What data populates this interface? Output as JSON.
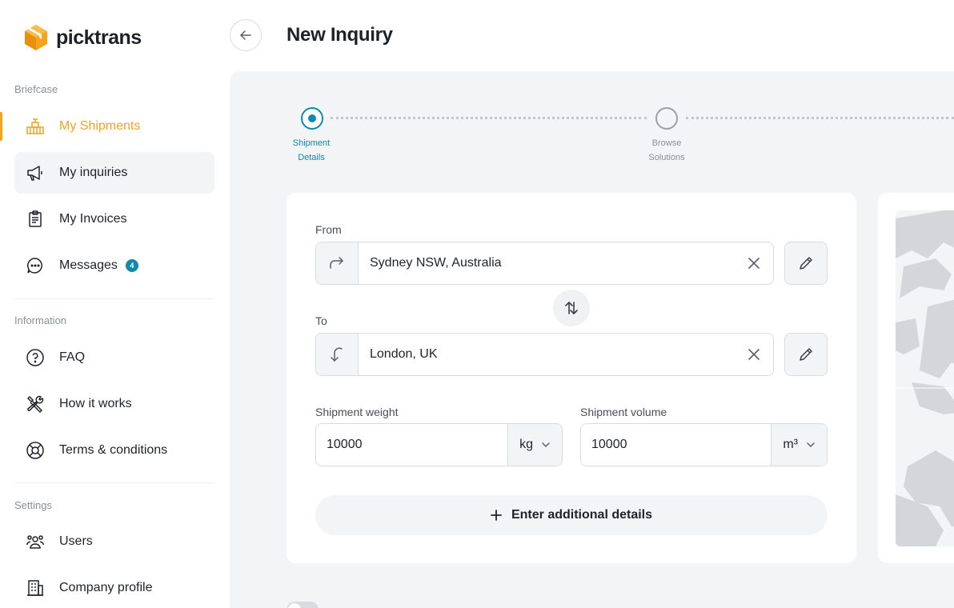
{
  "app": {
    "name": "picktrans",
    "brand_color": "#f5a21d",
    "accent_color": "#0e8ba8"
  },
  "sidebar": {
    "sections": [
      {
        "label": "Briefcase"
      },
      {
        "label": "Information"
      },
      {
        "label": "Settings"
      }
    ],
    "items": [
      {
        "label": "My Shipments",
        "icon": "warehouse-icon",
        "active": true
      },
      {
        "label": "My inquiries",
        "icon": "megaphone-icon"
      },
      {
        "label": "My Invoices",
        "icon": "invoice-icon"
      },
      {
        "label": "Messages",
        "icon": "chat-bubble-icon",
        "badge": "4"
      },
      {
        "label": "FAQ",
        "icon": "question-circle-icon"
      },
      {
        "label": "How it works",
        "icon": "tools-icon"
      },
      {
        "label": "Terms & conditions",
        "icon": "lifebuoy-icon"
      },
      {
        "label": "Users",
        "icon": "users-icon"
      },
      {
        "label": "Company profile",
        "icon": "building-icon"
      }
    ]
  },
  "header": {
    "title": "New Inquiry"
  },
  "stepper": {
    "steps": [
      {
        "line1": "Shipment",
        "line2": "Details",
        "state": "active"
      },
      {
        "line1": "Browse",
        "line2": "Solutions",
        "state": "pending"
      }
    ]
  },
  "form": {
    "from": {
      "label": "From",
      "value": "Sydney NSW, Australia"
    },
    "to": {
      "label": "To",
      "value": "London, UK"
    },
    "weight": {
      "label": "Shipment weight",
      "value": "10000",
      "unit": "kg"
    },
    "volume": {
      "label": "Shipment volume",
      "value": "10000",
      "unit": "m³"
    },
    "additional_details": "Enter additional details"
  }
}
